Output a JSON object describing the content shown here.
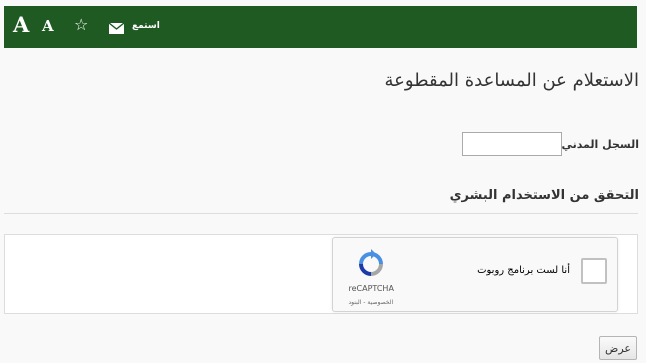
{
  "toolbar": {
    "increase_font_label": "A",
    "decrease_font_label": "A",
    "favorite_icon": "star-icon",
    "email_icon": "envelope-icon",
    "listen_label": "استمع",
    "background_color": "#1f5a22"
  },
  "form": {
    "title": "الاستعلام عن المساعدة المقطوعة",
    "civil_record_label": "السجل المدني",
    "required_marker": "*",
    "civil_record_value": "",
    "human_verification_title": "التحقق من الاستخدام البشري",
    "submit_label": "عرض"
  },
  "recaptcha": {
    "checkbox_label": "أنا لست برنامج روبوت",
    "brand": "reCAPTCHA",
    "terms": "الخصوصية - البنود",
    "checked": false
  },
  "colors": {
    "required": "#cc0000",
    "recaptcha_blue": "#4a90e2",
    "recaptcha_gray": "#a6a6a6"
  }
}
